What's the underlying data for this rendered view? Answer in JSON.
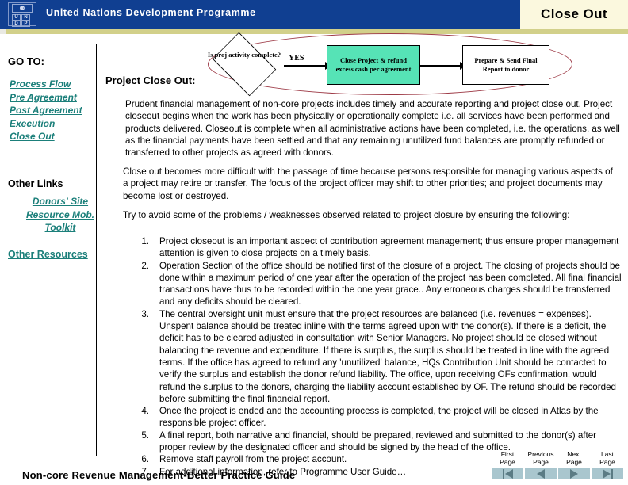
{
  "header": {
    "org_name": "United Nations Development Programme",
    "page_title": "Close Out",
    "logo": {
      "emblem": "UN",
      "letters": [
        "U",
        "N",
        "D",
        "P"
      ]
    }
  },
  "sidebar": {
    "goto_label": "GO TO:",
    "links": [
      {
        "label": "Process Flow"
      },
      {
        "label": "Pre Agreement"
      },
      {
        "label": "Post Agreement"
      },
      {
        "label": "Execution"
      },
      {
        "label": "Close Out"
      }
    ],
    "other_links_label": "Other Links",
    "other_links": [
      {
        "label": "Donors' Site"
      },
      {
        "label": "Resource Mob."
      },
      {
        "label": "Toolkit"
      }
    ],
    "other_resources_label": "Other Resources"
  },
  "flowchart": {
    "decision": "Is proj activity complete?",
    "branch_label": "YES",
    "step_1": "Close Project & refund excess cash per agreement",
    "step_2": "Prepare & Send Final Report to donor",
    "highlight_color": "#9e3b47",
    "step_1_fill": "#56e3b6"
  },
  "main": {
    "section_heading": "Project Close Out:",
    "paragraphs": [
      "Prudent financial management of non-core projects includes timely and accurate reporting and project  close out.  Project closeout begins when the work has been physically or operationally complete i.e. all services have been performed and products delivered.  Closeout is complete when all administrative actions have been completed, i.e. the operations, as well as the financial payments have been settled and that any remaining unutilized fund balances are promptly refunded or transferred to other projects as agreed with donors.",
      "Close out becomes more difficult with the passage of time because persons responsible for managing various aspects of a project may retire or transfer.  The focus of the project officer may shift to other priorities; and project documents may become lost or destroyed.",
      "Try to avoid some of the problems / weaknesses observed related to project closure by ensuring the following:"
    ],
    "numbered_items": [
      {
        "num": "1.",
        "text": "Project closeout is an important aspect of contribution agreement management; thus ensure proper management attention is given to close projects on a timely basis."
      },
      {
        "num": "2.",
        "text": "Operation Section of the office should be notified first of the closure of a project. The closing of projects should be done within a maximum period of one year after the operation of the project has been completed. All final financial transactions have thus to be recorded within the one year grace..  Any erroneous charges should be transferred  and any deficits should be cleared."
      },
      {
        "num": "3.",
        "text": "The central oversight unit  must ensure that the project resources are balanced (i.e. revenues = expenses). Unspent balance should be treated inline with the terms agreed upon with the donor(s).  If there is a deficit, the deficit has to be cleared adjusted in consultation with Senior Managers.  No project should be closed without balancing the revenue and expenditure.  If there is surplus, the surplus should be treated in line with the agreed terms.  If the office has agreed to refund any 'unutilized' balance, HQs Contribution Unit should be contacted to verify the surplus and establish the donor refund liability.  The office, upon receiving OFs confirmation, would refund the surplus to the donors, charging the liability account established by OF.  The refund should be recorded before submitting the final financial report."
      },
      {
        "num": "4.",
        "text": "Once the project is ended and the accounting process is completed, the project will be closed  in Atlas by the responsible project officer."
      },
      {
        "num": "5.",
        "text": "A final report, both narrative and financial, should be prepared, reviewed and submitted to the donor(s) after proper review by the designated officer and should be signed by the head of the office."
      },
      {
        "num": "6.",
        "text": "Remove staff payroll from the project account."
      },
      {
        "num": "7.",
        "text": "For additional information, refer to Programme User Guide…"
      }
    ]
  },
  "footer": {
    "guide_title": "Non-core Revenue Management-Better Practice Guide",
    "pager": [
      {
        "label": "First\nPage",
        "icon": "first-page-icon"
      },
      {
        "label": "Previous\nPage",
        "icon": "previous-page-icon"
      },
      {
        "label": "Next\nPage",
        "icon": "next-page-icon"
      },
      {
        "label": "Last\nPage",
        "icon": "last-page-icon"
      }
    ]
  }
}
